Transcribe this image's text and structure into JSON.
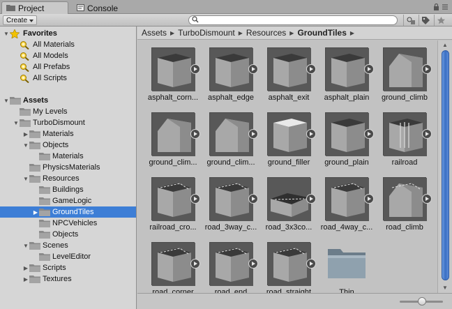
{
  "tabs": {
    "project_label": "Project",
    "console_label": "Console"
  },
  "toolbar": {
    "create_label": "Create",
    "search_placeholder": ""
  },
  "tree": [
    {
      "label": "Favorites",
      "bold": true,
      "depth": 0,
      "expanded": true,
      "icon": "star-icon"
    },
    {
      "label": "All Materials",
      "depth": 1,
      "icon": "search-icon"
    },
    {
      "label": "All Models",
      "depth": 1,
      "icon": "search-icon"
    },
    {
      "label": "All Prefabs",
      "depth": 1,
      "icon": "search-icon"
    },
    {
      "label": "All Scripts",
      "depth": 1,
      "icon": "search-icon"
    },
    {
      "label": "",
      "depth": 0,
      "spacer": true
    },
    {
      "label": "Assets",
      "bold": true,
      "depth": 0,
      "expanded": true,
      "icon": "folder-icon"
    },
    {
      "label": "My Levels",
      "depth": 1,
      "icon": "folder-icon"
    },
    {
      "label": "TurboDismount",
      "depth": 1,
      "expanded": true,
      "icon": "folder-icon"
    },
    {
      "label": "Materials",
      "depth": 2,
      "collapsed": true,
      "icon": "folder-icon"
    },
    {
      "label": "Objects",
      "depth": 2,
      "expanded": true,
      "icon": "folder-icon"
    },
    {
      "label": "Materials",
      "depth": 3,
      "icon": "folder-icon"
    },
    {
      "label": "PhysicsMaterials",
      "depth": 2,
      "icon": "folder-icon"
    },
    {
      "label": "Resources",
      "depth": 2,
      "expanded": true,
      "icon": "folder-icon"
    },
    {
      "label": "Buildings",
      "depth": 3,
      "icon": "folder-icon"
    },
    {
      "label": "GameLogic",
      "depth": 3,
      "icon": "folder-icon"
    },
    {
      "label": "GroundTiles",
      "depth": 3,
      "collapsed": true,
      "selected": true,
      "icon": "folder-icon"
    },
    {
      "label": "NPCVehicles",
      "depth": 3,
      "icon": "folder-icon"
    },
    {
      "label": "Objects",
      "depth": 3,
      "icon": "folder-icon"
    },
    {
      "label": "Scenes",
      "depth": 2,
      "expanded": true,
      "icon": "folder-icon"
    },
    {
      "label": "LevelEditor",
      "depth": 3,
      "icon": "folder-icon"
    },
    {
      "label": "Scripts",
      "depth": 2,
      "collapsed": true,
      "icon": "folder-icon"
    },
    {
      "label": "Textures",
      "depth": 2,
      "collapsed": true,
      "icon": "folder-icon"
    }
  ],
  "breadcrumb": [
    "Assets",
    "TurboDismount",
    "Resources",
    "GroundTiles"
  ],
  "assets": [
    {
      "label": "asphalt_corn...",
      "variant": "plain"
    },
    {
      "label": "asphalt_edge",
      "variant": "plain"
    },
    {
      "label": "asphalt_exit",
      "variant": "plain"
    },
    {
      "label": "asphalt_plain",
      "variant": "plain"
    },
    {
      "label": "ground_climb",
      "variant": "slope"
    },
    {
      "label": "ground_clim...",
      "variant": "slope"
    },
    {
      "label": "ground_clim...",
      "variant": "slope2"
    },
    {
      "label": "ground_filler",
      "variant": "light"
    },
    {
      "label": "ground_plain",
      "variant": "plain"
    },
    {
      "label": "railroad",
      "variant": "rail"
    },
    {
      "label": "railroad_cro...",
      "variant": "road"
    },
    {
      "label": "road_3way_c...",
      "variant": "road"
    },
    {
      "label": "road_3x3co...",
      "variant": "flat"
    },
    {
      "label": "road_4way_c...",
      "variant": "road"
    },
    {
      "label": "road_climb",
      "variant": "roadslope"
    },
    {
      "label": "road_corner",
      "variant": "road"
    },
    {
      "label": "road_end",
      "variant": "road"
    },
    {
      "label": "road_straight",
      "variant": "road"
    },
    {
      "label": "Thin",
      "variant": "folder"
    }
  ],
  "colors": {
    "selection": "#3d7ed6",
    "scroll_thumb": "#3a6fc4"
  }
}
